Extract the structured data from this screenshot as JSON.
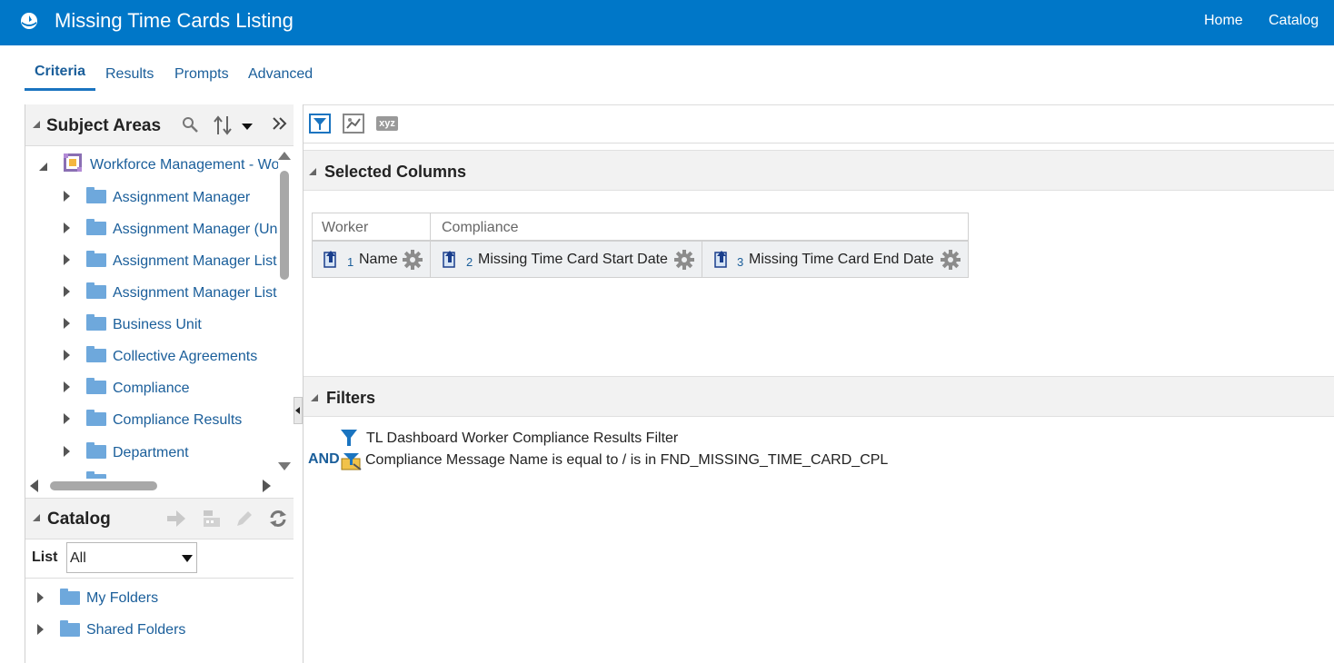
{
  "header": {
    "title": "Missing Time Cards Listing",
    "nav": {
      "home": "Home",
      "catalog": "Catalog"
    }
  },
  "tabs": [
    {
      "label": "Criteria",
      "active": true
    },
    {
      "label": "Results",
      "active": false
    },
    {
      "label": "Prompts",
      "active": false
    },
    {
      "label": "Advanced",
      "active": false
    }
  ],
  "subject_areas": {
    "title": "Subject Areas",
    "root": "Workforce Management - Worker Time Compliance Real Time",
    "items": [
      "Assignment Manager",
      "Assignment Manager (Unsecured)",
      "Assignment Manager List",
      "Assignment Manager List (Unsecured)",
      "Business Unit",
      "Collective Agreements",
      "Compliance",
      "Compliance Results",
      "Department"
    ]
  },
  "catalog": {
    "title": "Catalog",
    "list_label": "List",
    "list_value": "All",
    "items": [
      "My Folders",
      "Shared Folders"
    ]
  },
  "toolbar": {
    "xyz_label": "xyz"
  },
  "selected_columns": {
    "title": "Selected Columns",
    "groups": [
      "Worker",
      "Compliance"
    ],
    "columns": [
      {
        "num": "1",
        "name": "Name"
      },
      {
        "num": "2",
        "name": "Missing Time Card Start Date"
      },
      {
        "num": "3",
        "name": "Missing Time Card End Date"
      }
    ]
  },
  "filters": {
    "title": "Filters",
    "saved_filter": "TL Dashboard Worker Compliance Results Filter",
    "operator": "AND",
    "condition": "Compliance Message Name is equal to / is in  FND_MISSING_TIME_CARD_CPL"
  },
  "colors": {
    "header_bg": "#0077c8",
    "link": "#1a5e9a",
    "folder": "#6ea8dc",
    "panel_bg": "#f2f2f2"
  }
}
